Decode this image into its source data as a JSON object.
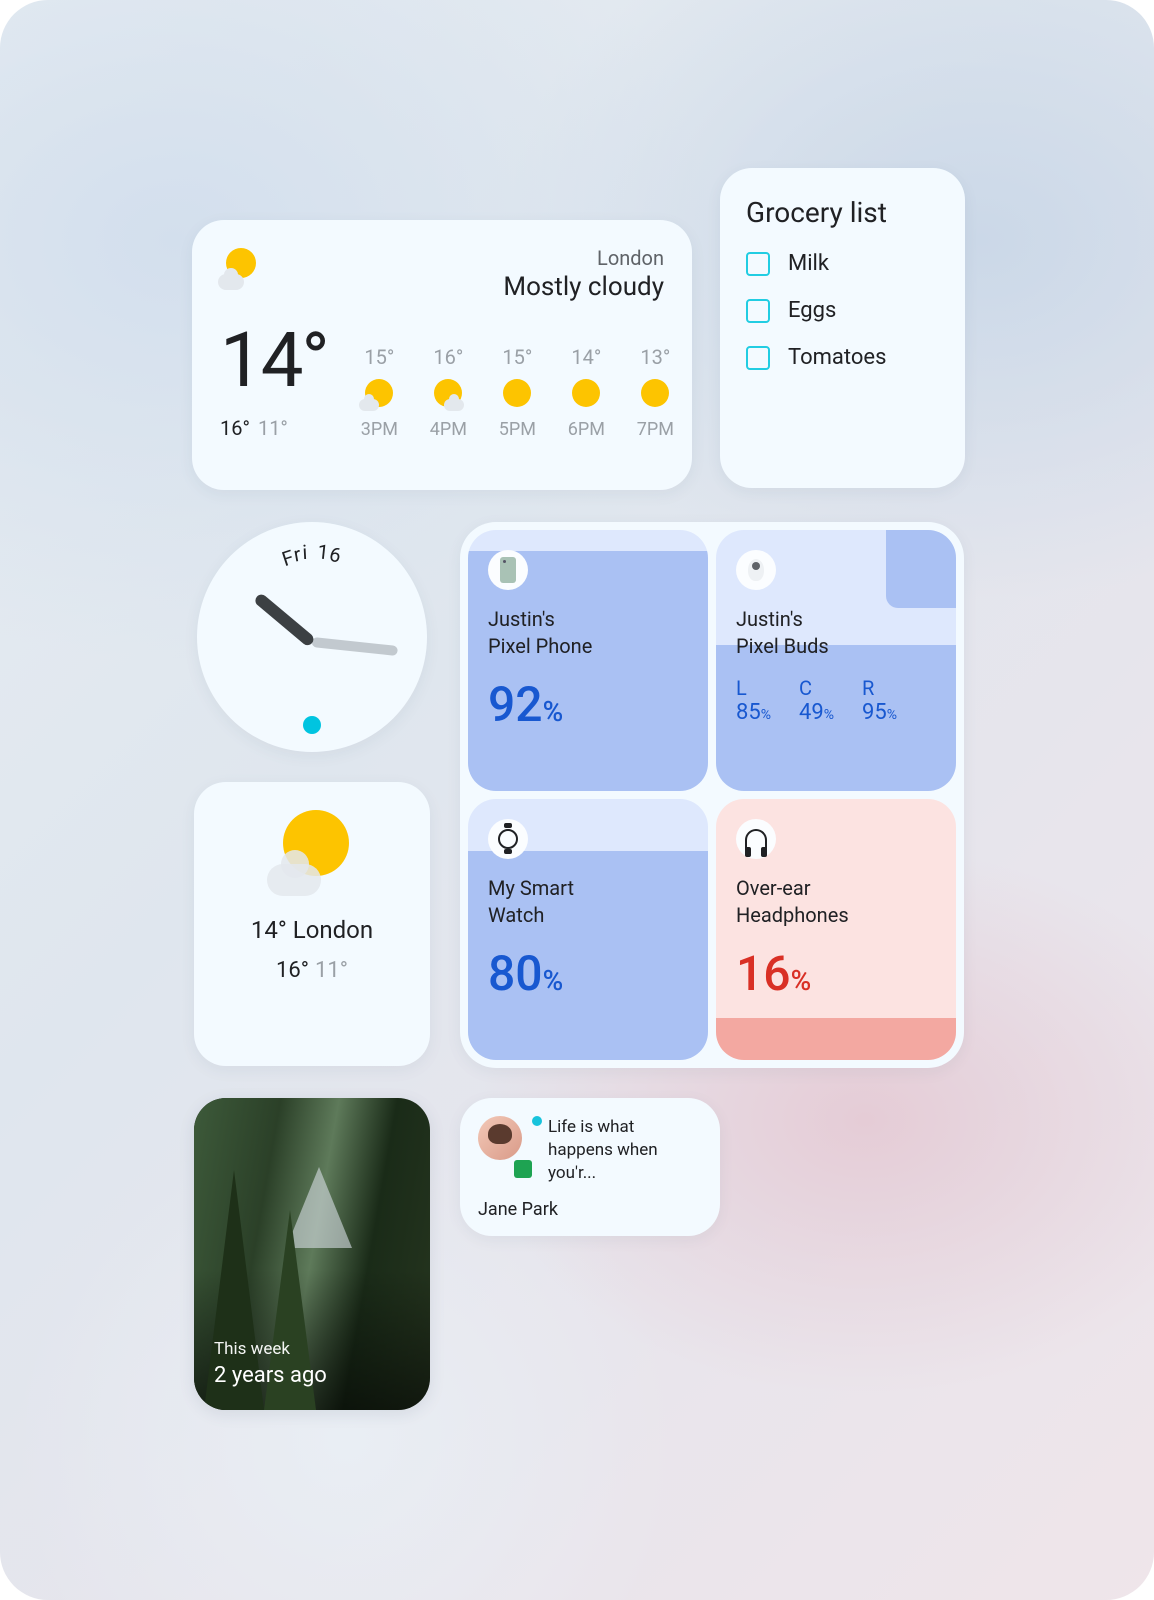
{
  "weather_big": {
    "city": "London",
    "condition": "Mostly cloudy",
    "temp": "14°",
    "high": "16°",
    "low": "11°",
    "forecast": [
      {
        "temp": "15°",
        "time": "3PM"
      },
      {
        "temp": "16°",
        "time": "4PM"
      },
      {
        "temp": "15°",
        "time": "5PM"
      },
      {
        "temp": "14°",
        "time": "6PM"
      },
      {
        "temp": "13°",
        "time": "7PM"
      }
    ]
  },
  "grocery": {
    "title": "Grocery list",
    "items": [
      "Milk",
      "Eggs",
      "Tomatoes"
    ]
  },
  "clock": {
    "day": "Fri 16"
  },
  "battery": {
    "phone": {
      "name_l1": "Justin's",
      "name_l2": "Pixel Phone",
      "pct": "92"
    },
    "buds": {
      "name_l1": "Justin's",
      "name_l2": "Pixel Buds",
      "L": "85",
      "C": "49",
      "R": "95"
    },
    "watch": {
      "name_l1": "My Smart",
      "name_l2": "Watch",
      "pct": "80"
    },
    "headphones": {
      "name_l1": "Over-ear",
      "name_l2": "Headphones",
      "pct": "16"
    }
  },
  "weather_small": {
    "temp": "14°",
    "city": "London",
    "high": "16°",
    "low": "11°"
  },
  "photo": {
    "line1": "This week",
    "line2": "2 years ago"
  },
  "message": {
    "text": "Life is what happens when you'r...",
    "sender": "Jane Park"
  },
  "labels": {
    "L": "L",
    "C": "C",
    "R": "R",
    "pct": "%"
  }
}
